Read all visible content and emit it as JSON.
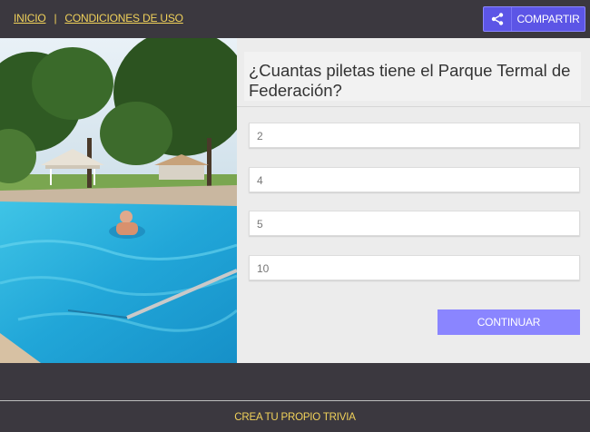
{
  "nav": {
    "home_label": "INICIO",
    "separator": "|",
    "terms_label": "CONDICIONES DE USO"
  },
  "share": {
    "icon": "share-icon",
    "label": "COMPARTIR"
  },
  "photo": {
    "alt": "Pileta del Parque Termal de Federación"
  },
  "quiz": {
    "question": "¿Cuantas piletas tiene el Parque Termal de Federación?",
    "options": [
      {
        "label": "2"
      },
      {
        "label": "4"
      },
      {
        "label": "5"
      },
      {
        "label": "10"
      }
    ],
    "continue_label": "CONTINUAR"
  },
  "footer": {
    "create_label": "CREA TU PROPIO TRIVIA"
  },
  "colors": {
    "background": "#3b383f",
    "link": "#f1d25a",
    "accent": "#5c55e6",
    "continue": "#8a85ff",
    "panel": "#ececec"
  }
}
